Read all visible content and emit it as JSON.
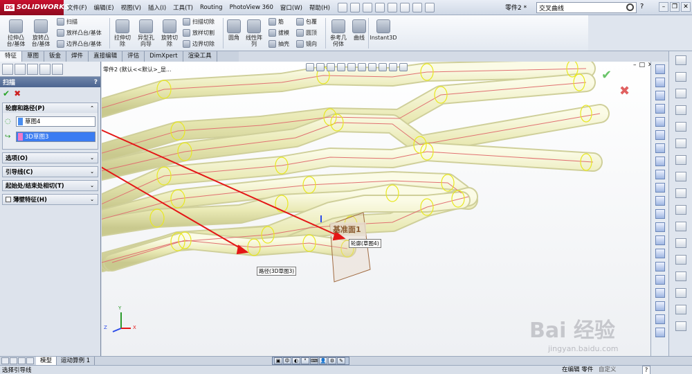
{
  "app": {
    "brand": "SOLIDWORKS",
    "brand_prefix": "DS",
    "menus": [
      "文件(F)",
      "编辑(E)",
      "视图(V)",
      "插入(I)",
      "工具(T)",
      "Routing",
      "PhotoView 360",
      "窗口(W)",
      "帮助(H)"
    ],
    "document_name": "零件2 *",
    "search_value": "交叉曲线",
    "help_label": "?"
  },
  "toolbar": {
    "extrude_boss": "拉伸凸\n台/基体",
    "revolve_boss": "旋转凸\n台/基体",
    "sweep": "扫描",
    "loft": "放样凸台/基体",
    "boundary_boss": "边界凸台/基体",
    "extrude_cut": "拉伸切\n除",
    "hole_wizard": "异型孔\n向导",
    "revolve_cut": "旋转切\n除",
    "swept_cut": "扫描切除",
    "lofted_cut": "放样切割",
    "boundary_cut": "边界切除",
    "fillet": "圆角",
    "linear_pattern": "线性阵\n列",
    "rib": "筋",
    "draft": "拔模",
    "shell": "抽壳",
    "wrap": "包覆",
    "dome": "圆顶",
    "mirror": "镜向",
    "ref_geometry": "参考几\n何体",
    "curves": "曲线",
    "instant3d": "Instant3D"
  },
  "tabs": [
    "特征",
    "草图",
    "钣金",
    "焊件",
    "直接编辑",
    "评估",
    "DimXpert",
    "渲染工具"
  ],
  "propertymanager": {
    "title": "扫描",
    "help": "?",
    "profile_path_label": "轮廓和路径(P)",
    "profile_value": "草图4",
    "path_value": "3D草图3",
    "options_label": "选项(O)",
    "guide_label": "引导线(C)",
    "tangency_label": "起始处/结束处相切(T)",
    "thin_label": "薄壁特征(H)",
    "colors": {
      "profile": "#4a8ef0",
      "path": "#f07ac8"
    }
  },
  "viewport": {
    "tree_label": "零件2 (默认<<默认>_显...",
    "plane_label": "基准面1",
    "profile_callout": "轮廓(草图4)",
    "path_callout": "路径(3D草图3)",
    "axes": {
      "y": "Y",
      "x": "X",
      "z": "Z"
    }
  },
  "bottom": {
    "tabs": [
      "模型",
      "运动算例 1"
    ]
  },
  "status": {
    "left": "选择引导线",
    "right": "在编辑 零件",
    "custom": "自定义",
    "help": "?"
  },
  "watermark": {
    "main": "Bai 经验",
    "sub": "jingyan.baidu.com"
  }
}
